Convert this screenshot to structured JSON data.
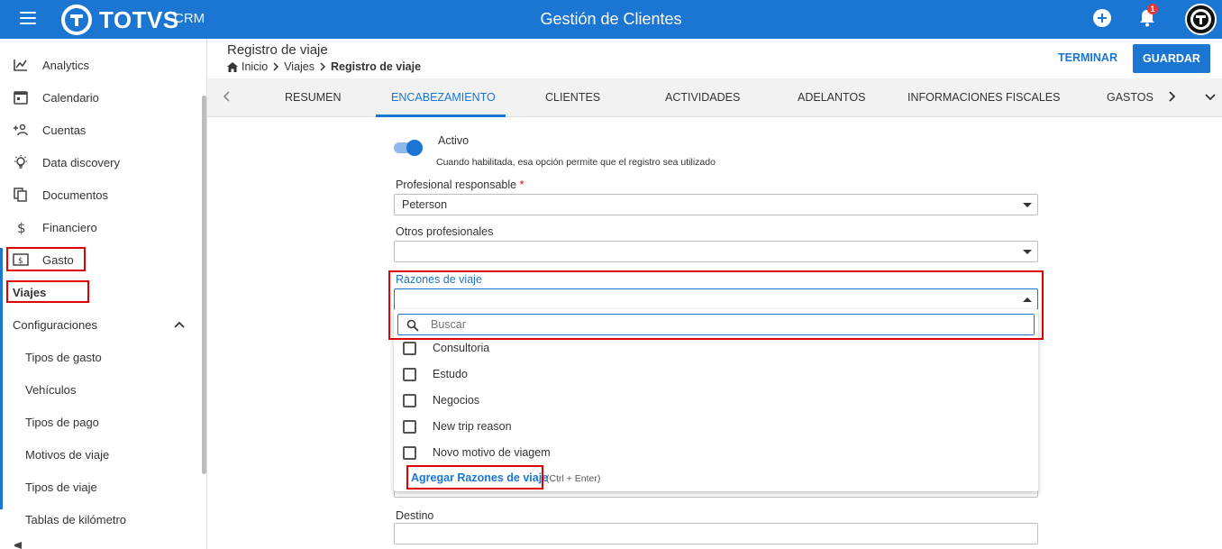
{
  "topbar": {
    "brand": "TOTVS",
    "brand_sub": "CRM",
    "title": "Gestión de Clientes",
    "notification_count": "1",
    "color": "#1a76d2"
  },
  "sidebar": {
    "items": [
      {
        "label": "Analytics",
        "icon": "chart-line-icon"
      },
      {
        "label": "Calendario",
        "icon": "calendar-icon"
      },
      {
        "label": "Cuentas",
        "icon": "add-users-icon"
      },
      {
        "label": "Data discovery",
        "icon": "lightbulb-icon"
      },
      {
        "label": "Documentos",
        "icon": "documents-icon"
      },
      {
        "label": "Financiero",
        "icon": "dollar-icon"
      },
      {
        "label": "Gasto",
        "icon": "money-note-icon"
      }
    ],
    "active_item": "Viajes",
    "section": "Configuraciones",
    "sub_items": [
      {
        "label": "Tipos de gasto"
      },
      {
        "label": "Vehículos"
      },
      {
        "label": "Tipos de pago"
      },
      {
        "label": "Motivos de viaje"
      },
      {
        "label": "Tipos de viaje"
      },
      {
        "label": "Tablas de kilómetro"
      }
    ]
  },
  "header": {
    "title": "Registro de viaje",
    "breadcrumb": [
      "Inicio",
      "Viajes",
      "Registro de viaje"
    ],
    "finish_label": "TERMINAR",
    "save_label": "GUARDAR"
  },
  "tabs": [
    {
      "label": "RESUMEN"
    },
    {
      "label": "ENCABEZAMIENTO"
    },
    {
      "label": "CLIENTES"
    },
    {
      "label": "ACTIVIDADES"
    },
    {
      "label": "ADELANTOS"
    },
    {
      "label": "INFORMACIONES FISCALES"
    },
    {
      "label": "GASTOS"
    }
  ],
  "form": {
    "active_label": "Activo",
    "active_help": "Cuando habilitada, esa opción permite que el registro sea utilizado",
    "active": true,
    "responsible_label": "Profesional responsable",
    "responsible_required": "*",
    "responsible_value": "Peterson",
    "others_label": "Otros profesionales",
    "others_value": "",
    "reasons_label": "Razones de viaje",
    "reasons_value": "",
    "search_placeholder": "Buscar",
    "reason_options": [
      {
        "label": "Consultoria",
        "checked": false
      },
      {
        "label": "Estudo",
        "checked": false
      },
      {
        "label": "Negocios",
        "checked": false
      },
      {
        "label": "New trip reason",
        "checked": false
      },
      {
        "label": "Novo motivo de viagem",
        "checked": false
      }
    ],
    "add_reason_label": "Agregar Razones de viaje",
    "add_reason_hint": "(Ctrl + Enter)",
    "destination_label": "Destino",
    "destination_value": ""
  }
}
